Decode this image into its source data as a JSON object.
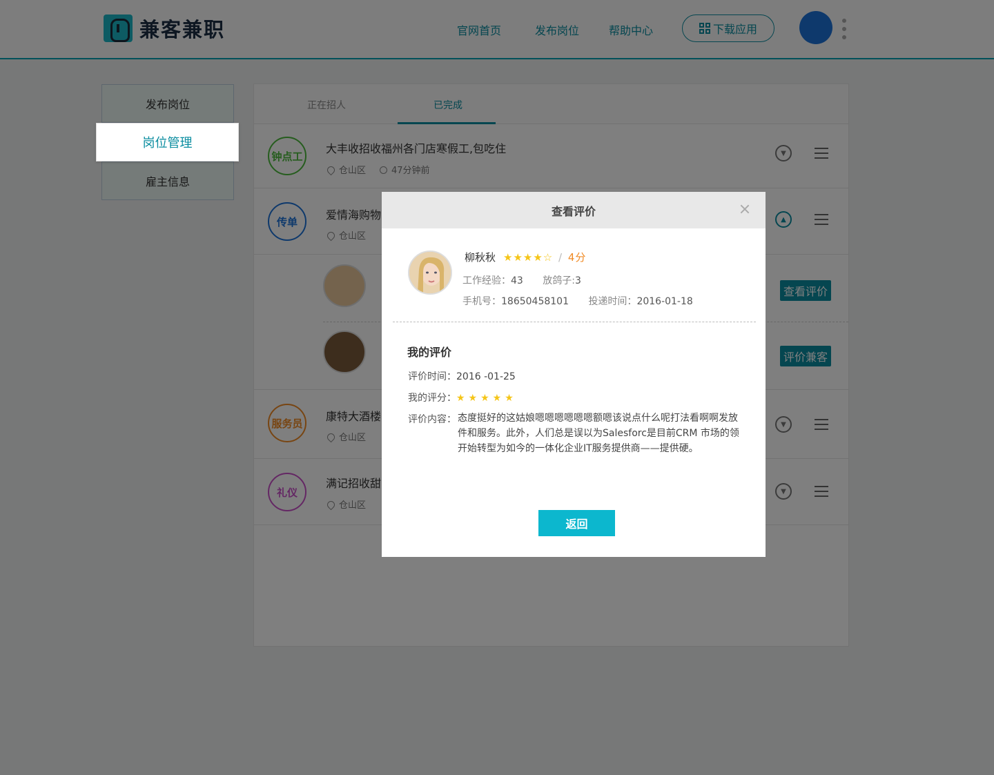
{
  "header": {
    "logo_text": "兼客兼职",
    "nav": [
      "官网首页",
      "发布岗位",
      "帮助中心"
    ],
    "download": "下载应用"
  },
  "sidebar": {
    "items": [
      {
        "label": "发布岗位"
      },
      {
        "label": "岗位管理"
      },
      {
        "label": "雇主信息"
      }
    ]
  },
  "tabs": [
    "正在招人",
    "已完成"
  ],
  "jobs": [
    {
      "badge": "钟点工",
      "badge_color": "#4cba3c",
      "title": "大丰收招收福州各门店寒假工,包吃住",
      "district": "仓山区",
      "time": "47分钟前"
    },
    {
      "badge": "传单",
      "badge_color": "#1c73d8",
      "title": "爱情海购物",
      "district": "仓山区"
    },
    {
      "badge": "服务员",
      "badge_color": "#f08a24",
      "title": "康特大酒楼",
      "district": "仓山区"
    },
    {
      "badge": "礼仪",
      "badge_color": "#c94fc9",
      "title": "满记招收甜",
      "district": "仓山区"
    }
  ],
  "applicant_buttons": [
    "查看评价",
    "评价兼客"
  ],
  "modal": {
    "title": "查看评价",
    "candidate": {
      "name": "柳秋秋",
      "stars_filled": "★★★★",
      "stars_empty": "☆",
      "rating": 4,
      "slash": "/",
      "score_text": "4分",
      "experience_label": "工作经验：",
      "experience_value": "43",
      "pigeon_label": "放鸽子:",
      "pigeon_value": "3",
      "phone_label": "手机号：",
      "phone_value": "18650458101",
      "apply_label": "投递时间：",
      "apply_value": "2016-01-18"
    },
    "my_review": {
      "title": "我的评价",
      "time_label": "评价时间：",
      "time_value": "2016 -01-25",
      "score_label": "我的评分：",
      "stars": "★★★★★",
      "rating": 5,
      "content_label": "评价内容：",
      "content": "态度挺好的这姑娘嗯嗯嗯嗯嗯嗯额嗯该说点什么呢打法看啊啊发放件和服务。此外，人们总是误以为Salesforc是目前CRM 市场的领开始转型为如今的一体化企业IT服务提供商——提供硬。"
    },
    "return_label": "返回"
  }
}
